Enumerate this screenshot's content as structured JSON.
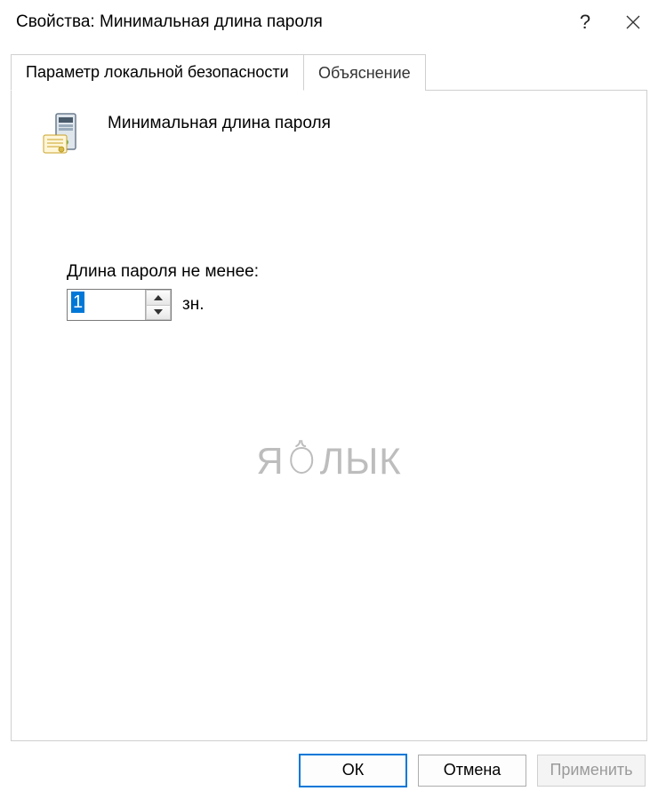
{
  "window": {
    "title": "Свойства: Минимальная длина пароля"
  },
  "tabs": [
    {
      "label": "Параметр локальной безопасности"
    },
    {
      "label": "Объяснение"
    }
  ],
  "policy": {
    "title": "Минимальная длина пароля",
    "field_label": "Длина пароля не менее:",
    "value": "1",
    "unit": "зн."
  },
  "watermark": {
    "left": "Я",
    "right": "ЛЫК"
  },
  "buttons": {
    "ok": "ОК",
    "cancel": "Отмена",
    "apply": "Применить"
  }
}
